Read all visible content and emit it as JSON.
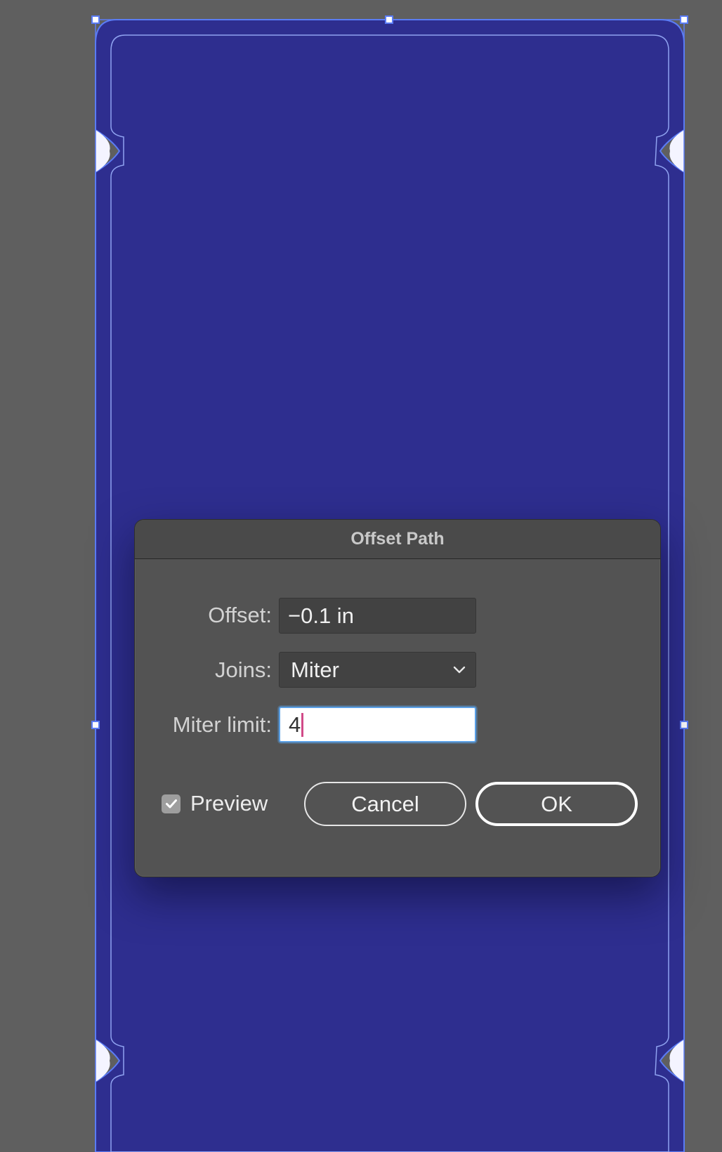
{
  "dialog": {
    "title": "Offset Path",
    "offset_label": "Offset:",
    "offset_value": "−0.1 in",
    "joins_label": "Joins:",
    "joins_value": "Miter",
    "miter_label": "Miter limit:",
    "miter_value": "4",
    "preview_label": "Preview",
    "preview_checked": true,
    "cancel_label": "Cancel",
    "ok_label": "OK"
  },
  "colors": {
    "background": "#5f5f5f",
    "artwork_fill": "#2e2e8f",
    "selection_blue": "#5b7cf5",
    "dialog_bg": "#535353"
  },
  "icons": {
    "joins_dropdown": "chevron-down-icon",
    "preview_checkbox": "checkmark-icon"
  }
}
